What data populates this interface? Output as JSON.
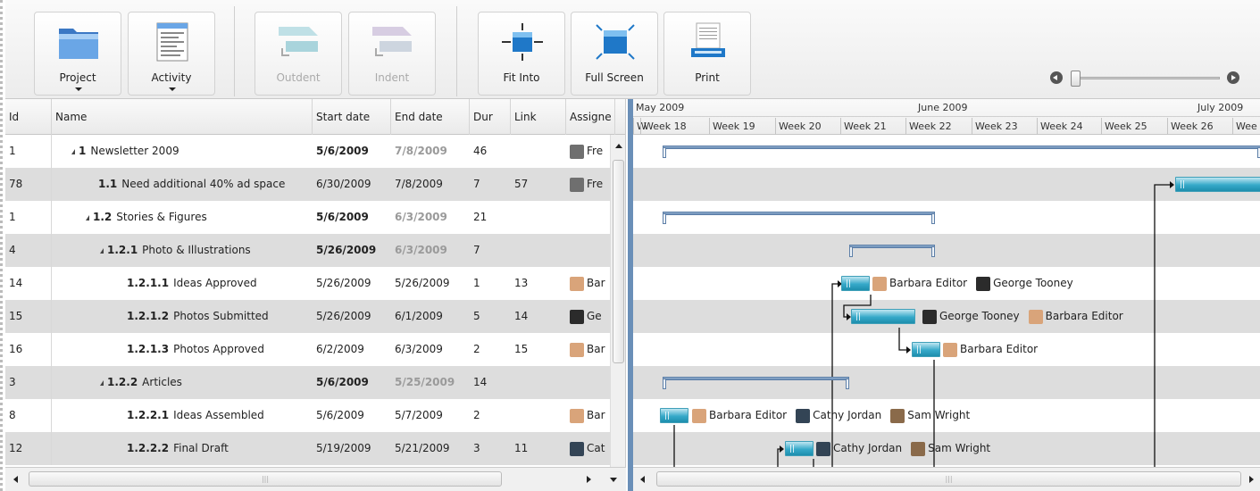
{
  "toolbar": {
    "project_label": "Project",
    "activity_label": "Activity",
    "outdent_label": "Outdent",
    "indent_label": "Indent",
    "fit_into_label": "Fit Into",
    "full_screen_label": "Full Screen",
    "print_label": "Print"
  },
  "grid": {
    "columns": [
      "Id",
      "Name",
      "Start date",
      "End date",
      "Dur",
      "Link",
      "Assigne"
    ],
    "rows": [
      {
        "id": "1",
        "wbs": "1",
        "name": "Newsletter 2009",
        "start": "5/6/2009",
        "end": "7/8/2009",
        "dur": "46",
        "link": "",
        "assignee": "Fre",
        "level": 0,
        "summary": true
      },
      {
        "id": "78",
        "wbs": "1.1",
        "name": "Need additional 40% ad space",
        "start": "6/30/2009",
        "end": "7/8/2009",
        "dur": "7",
        "link": "57",
        "assignee": "Fre",
        "level": 1,
        "summary": false
      },
      {
        "id": "1",
        "wbs": "1.2",
        "name": "Stories & Figures",
        "start": "5/6/2009",
        "end": "6/3/2009",
        "dur": "21",
        "link": "",
        "assignee": "",
        "level": 1,
        "summary": true
      },
      {
        "id": "4",
        "wbs": "1.2.1",
        "name": "Photo & Illustrations",
        "start": "5/26/2009",
        "end": "6/3/2009",
        "dur": "7",
        "link": "",
        "assignee": "",
        "level": 2,
        "summary": true
      },
      {
        "id": "14",
        "wbs": "1.2.1.1",
        "name": "Ideas Approved",
        "start": "5/26/2009",
        "end": "5/26/2009",
        "dur": "1",
        "link": "13",
        "assignee": "Bar",
        "level": 3,
        "summary": false
      },
      {
        "id": "15",
        "wbs": "1.2.1.2",
        "name": "Photos Submitted",
        "start": "5/26/2009",
        "end": "6/1/2009",
        "dur": "5",
        "link": "14",
        "assignee": "Ge",
        "level": 3,
        "summary": false
      },
      {
        "id": "16",
        "wbs": "1.2.1.3",
        "name": "Photos Approved",
        "start": "6/2/2009",
        "end": "6/3/2009",
        "dur": "2",
        "link": "15",
        "assignee": "Bar",
        "level": 3,
        "summary": false
      },
      {
        "id": "3",
        "wbs": "1.2.2",
        "name": "Articles",
        "start": "5/6/2009",
        "end": "5/25/2009",
        "dur": "14",
        "link": "",
        "assignee": "",
        "level": 2,
        "summary": true
      },
      {
        "id": "8",
        "wbs": "1.2.2.1",
        "name": "Ideas Assembled",
        "start": "5/6/2009",
        "end": "5/7/2009",
        "dur": "2",
        "link": "",
        "assignee": "Bar",
        "level": 3,
        "summary": false
      },
      {
        "id": "12",
        "wbs": "1.2.2.2",
        "name": "Final Draft",
        "start": "5/19/2009",
        "end": "5/21/2009",
        "dur": "3",
        "link": "11",
        "assignee": "Cat",
        "level": 3,
        "summary": false
      }
    ]
  },
  "timeline": {
    "months": [
      "May 2009",
      "June 2009",
      "July 2009"
    ],
    "weeks": [
      "W",
      "Week 18",
      "Week 19",
      "Week 20",
      "Week 21",
      "Week 22",
      "Week 23",
      "Week 24",
      "Week 25",
      "Week 26",
      "Wee"
    ]
  },
  "resources": {
    "r4": [
      "Barbara Editor",
      "George Tooney"
    ],
    "r5": [
      "George Tooney",
      "Barbara Editor"
    ],
    "r6": [
      "Barbara Editor"
    ],
    "r8": [
      "Barbara Editor",
      "Cathy Jordan",
      "Sam Wright"
    ],
    "r9": [
      "Cathy Jordan",
      "Sam Wright"
    ]
  },
  "colors": {
    "accent": "#6a8fb8",
    "task_bar": "#36a9c9",
    "alt_row": "#dddddd"
  }
}
